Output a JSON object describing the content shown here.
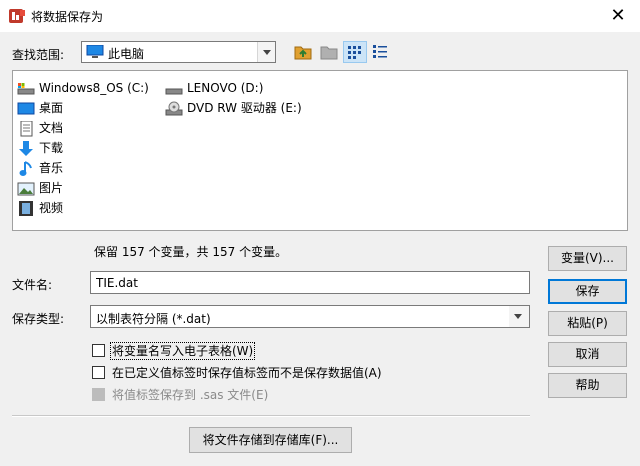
{
  "window": {
    "title": "将数据保存为",
    "close_glyph": "✕"
  },
  "lookin": {
    "label": "查找范围:",
    "value": "此电脑",
    "icon": "computer-icon"
  },
  "toolbar": {
    "icons": [
      "up-folder-icon",
      "new-folder-icon",
      "list-view-icon",
      "details-view-icon"
    ],
    "pressed": "list-view-icon"
  },
  "files": [
    {
      "label": "Windows8_OS (C:)",
      "icon": "drive-c-icon"
    },
    {
      "label": "桌面",
      "icon": "desktop-folder-icon"
    },
    {
      "label": "文档",
      "icon": "documents-icon"
    },
    {
      "label": "下载",
      "icon": "download-icon"
    },
    {
      "label": "音乐",
      "icon": "music-icon"
    },
    {
      "label": "图片",
      "icon": "pictures-icon"
    },
    {
      "label": "视频",
      "icon": "videos-icon"
    },
    {
      "label": "LENOVO (D:)",
      "icon": "drive-d-icon"
    },
    {
      "label": "DVD RW 驱动器 (E:)",
      "icon": "dvd-drive-icon"
    }
  ],
  "summary": "保留 157 个变量，共 157 个变量。",
  "filename": {
    "label": "文件名:",
    "value": "TIE.dat"
  },
  "filetype": {
    "label": "保存类型:",
    "value": "以制表符分隔 (*.dat)"
  },
  "options": [
    {
      "label": "将变量名写入电子表格(W)",
      "checked": false,
      "enabled": true
    },
    {
      "label": "在已定义值标签时保存值标签而不是保存数据值(A)",
      "checked": false,
      "enabled": true
    },
    {
      "label": "将值标签保存到 .sas 文件(E)",
      "checked": false,
      "enabled": false
    }
  ],
  "buttons": {
    "variables": "变量(V)...",
    "save": "保存",
    "paste": "粘贴(P)",
    "cancel": "取消",
    "help": "帮助",
    "store_repository": "将文件存储到存储库(F)..."
  },
  "colors": {
    "accent": "#0078d7",
    "background": "#f0f0f0"
  }
}
